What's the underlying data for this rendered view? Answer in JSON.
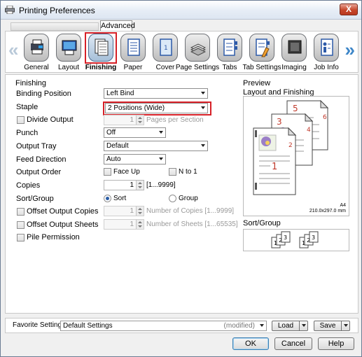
{
  "window": {
    "title": "Printing Preferences",
    "close_label": "X"
  },
  "tabs": {
    "advanced": "Advanced"
  },
  "toolbar": {
    "items": [
      {
        "label": "General",
        "icon": "general-icon"
      },
      {
        "label": "Layout",
        "icon": "layout-icon"
      },
      {
        "label": "Finishing",
        "icon": "finishing-icon",
        "selected": true
      },
      {
        "label": "Paper",
        "icon": "paper-icon"
      },
      {
        "label": "Cover",
        "icon": "cover-icon"
      },
      {
        "label": "Page Settings",
        "icon": "page-settings-icon"
      },
      {
        "label": "Tabs",
        "icon": "tabs-icon"
      },
      {
        "label": "Tab Settings",
        "icon": "tab-settings-icon"
      },
      {
        "label": "Imaging",
        "icon": "imaging-icon"
      },
      {
        "label": "Job Info",
        "icon": "job-info-icon"
      }
    ],
    "prev_glyph": "«",
    "next_glyph": "»"
  },
  "finishing": {
    "group_title": "Finishing",
    "binding_position": {
      "label": "Binding Position",
      "value": "Left Bind"
    },
    "staple": {
      "label": "Staple",
      "value": "2 Positions (Wide)"
    },
    "divide_output": {
      "label": "Divide Output",
      "value": "1",
      "hint": "Pages per Section"
    },
    "punch": {
      "label": "Punch",
      "value": "Off"
    },
    "output_tray": {
      "label": "Output Tray",
      "value": "Default"
    },
    "feed_direction": {
      "label": "Feed Direction",
      "value": "Auto"
    },
    "output_order": {
      "label": "Output Order",
      "face_up": "Face Up",
      "n_to_1": "N to 1"
    },
    "copies": {
      "label": "Copies",
      "value": "1",
      "range": "[1...9999]"
    },
    "sort_group": {
      "label": "Sort/Group",
      "sort": "Sort",
      "group": "Group",
      "selected": "Sort"
    },
    "offset_copies": {
      "label": "Offset Output Copies",
      "value": "1",
      "hint": "Number of Copies [1...9999]"
    },
    "offset_sheets": {
      "label": "Offset Output Sheets",
      "value": "1",
      "hint": "Number of Sheets [1...65535]"
    },
    "pile_permission": {
      "label": "Pile Permission"
    }
  },
  "preview": {
    "group_title": "Preview",
    "subtitle": "Layout and Finishing",
    "page_numbers": [
      "5",
      "6",
      "3",
      "4",
      "1",
      "2"
    ],
    "paper_size": "A4",
    "paper_dims": "210.0x297.0 mm",
    "sort_group_title": "Sort/Group",
    "stack_numbers": [
      "1",
      "2",
      "3",
      "1",
      "2",
      "3"
    ]
  },
  "favorite": {
    "label": "Favorite Setting",
    "value": "Default Settings",
    "modified": "(modified)",
    "load": "Load",
    "save": "Save"
  },
  "buttons": {
    "ok": "OK",
    "cancel": "Cancel",
    "help": "Help"
  },
  "colors": {
    "selection_red": "#d62027",
    "accent_blue": "#3d86c8"
  }
}
